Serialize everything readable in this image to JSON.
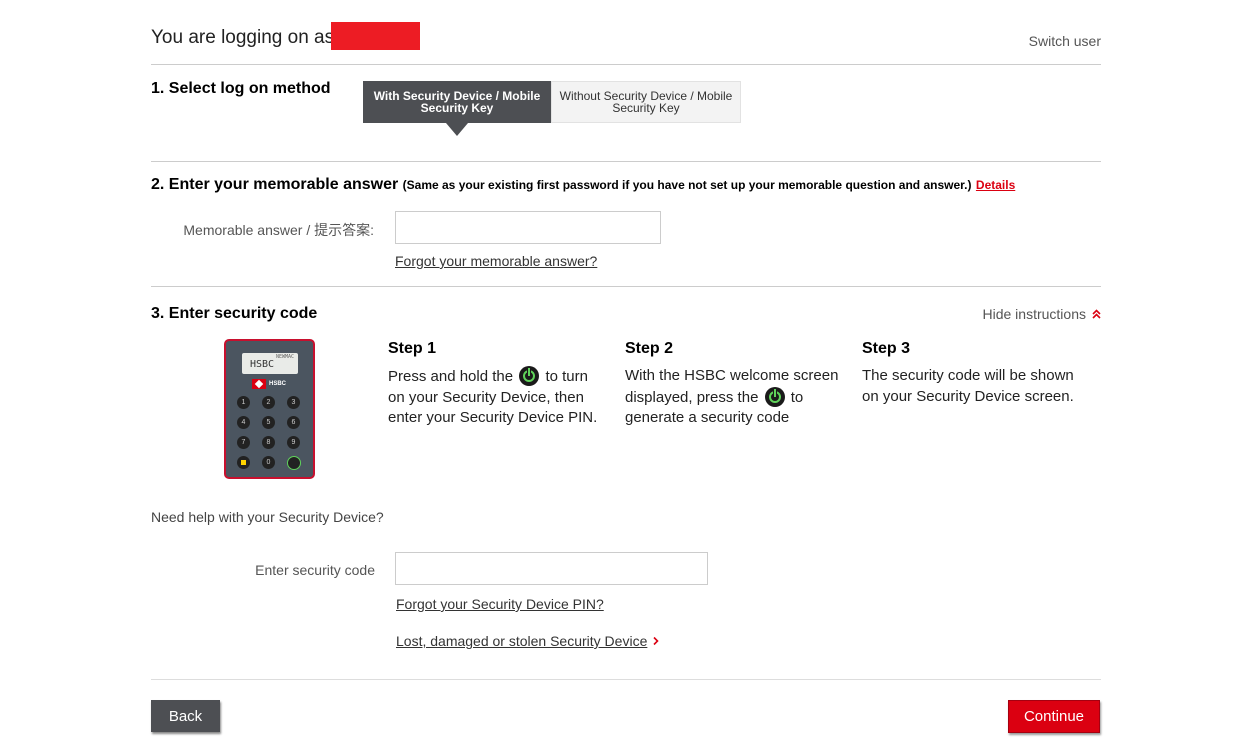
{
  "header": {
    "logging_label": "You are logging on as:",
    "switch_user": "Switch user"
  },
  "section1": {
    "title": "1. Select log on method",
    "tabs": [
      {
        "label": "With Security Device / Mobile Security Key",
        "active": true
      },
      {
        "label": "Without Security Device / Mobile Security Key",
        "active": false
      }
    ]
  },
  "section2": {
    "title": "2. Enter your memorable answer",
    "note": "(Same as your existing first password if you have not set up your memorable question and answer.)",
    "details_link": "Details",
    "field_label": "Memorable answer / 提示答案:",
    "field_value": "",
    "forgot_link": "Forgot your memorable answer?"
  },
  "section3": {
    "title": "3. Enter security code",
    "hide_instructions": "Hide instructions",
    "device": {
      "screen_text": "HSBC",
      "screen_sub": "NEWMAC",
      "brand": "HSBC",
      "keys": [
        "1",
        "2",
        "3",
        "4",
        "5",
        "6",
        "7",
        "8",
        "9",
        "",
        "0",
        ""
      ]
    },
    "steps": [
      {
        "title": "Step 1",
        "text_before": "Press and hold the",
        "text_after": "to turn on your Security Device, then enter your Security Device PIN."
      },
      {
        "title": "Step 2",
        "text_before": "With the HSBC welcome screen displayed, press the",
        "text_after": "to generate a security code"
      },
      {
        "title": "Step 3",
        "text_before": "The security code will be shown on your Security Device screen.",
        "text_after": ""
      }
    ],
    "help_text": "Need help with your Security Device?",
    "code_label": "Enter security code",
    "code_value": "",
    "forgot_pin_link": "Forgot your Security Device PIN?",
    "lost_link": "Lost, damaged or stolen Security Device"
  },
  "footer": {
    "back_label": "Back",
    "continue_label": "Continue"
  },
  "colors": {
    "accent_red": "#db0011",
    "dark_grey": "#4d4f53"
  }
}
